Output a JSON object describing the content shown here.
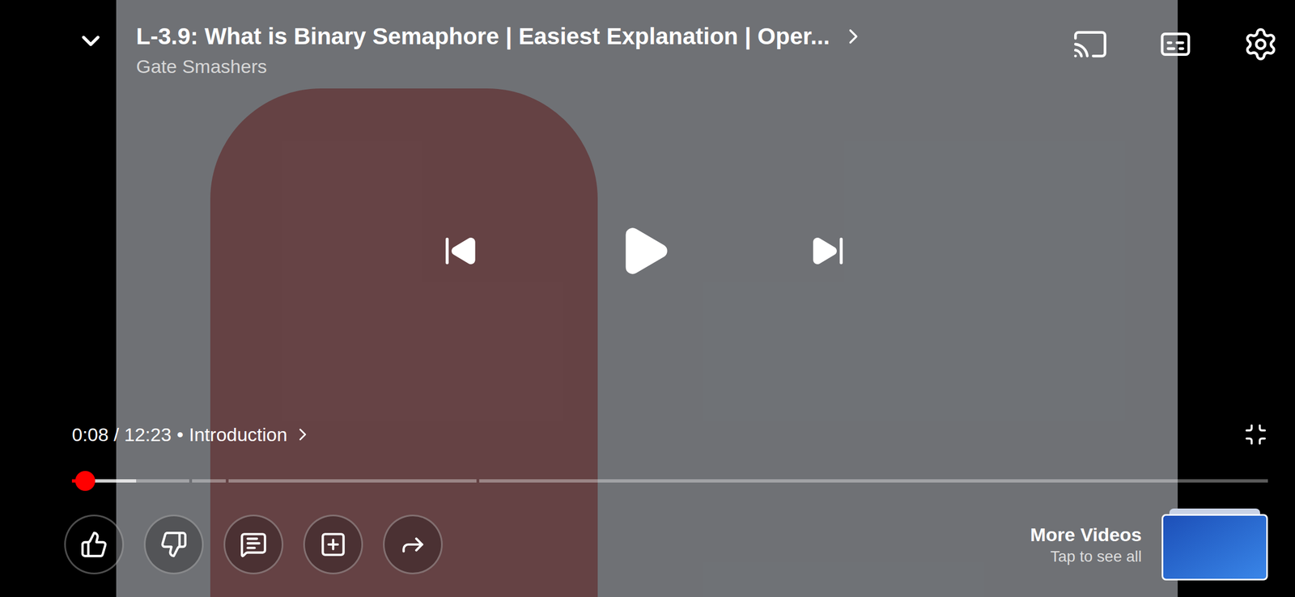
{
  "video": {
    "title": "L-3.9: What is Binary Semaphore | Easiest Explanation | Oper...",
    "channel": "Gate Smashers"
  },
  "player": {
    "playing": false,
    "time": "0:08 / 12:23",
    "separator": "•",
    "chapter": "Introduction",
    "progress": {
      "played": 0.011,
      "buffered": 0.054,
      "chapters": [
        {
          "level": 0.099
        },
        {
          "level": 0.028
        },
        {
          "level": 0.209
        },
        {
          "level": 0.664
        }
      ]
    }
  },
  "more_videos": {
    "label": "More Videos",
    "hint": "Tap to see all"
  }
}
